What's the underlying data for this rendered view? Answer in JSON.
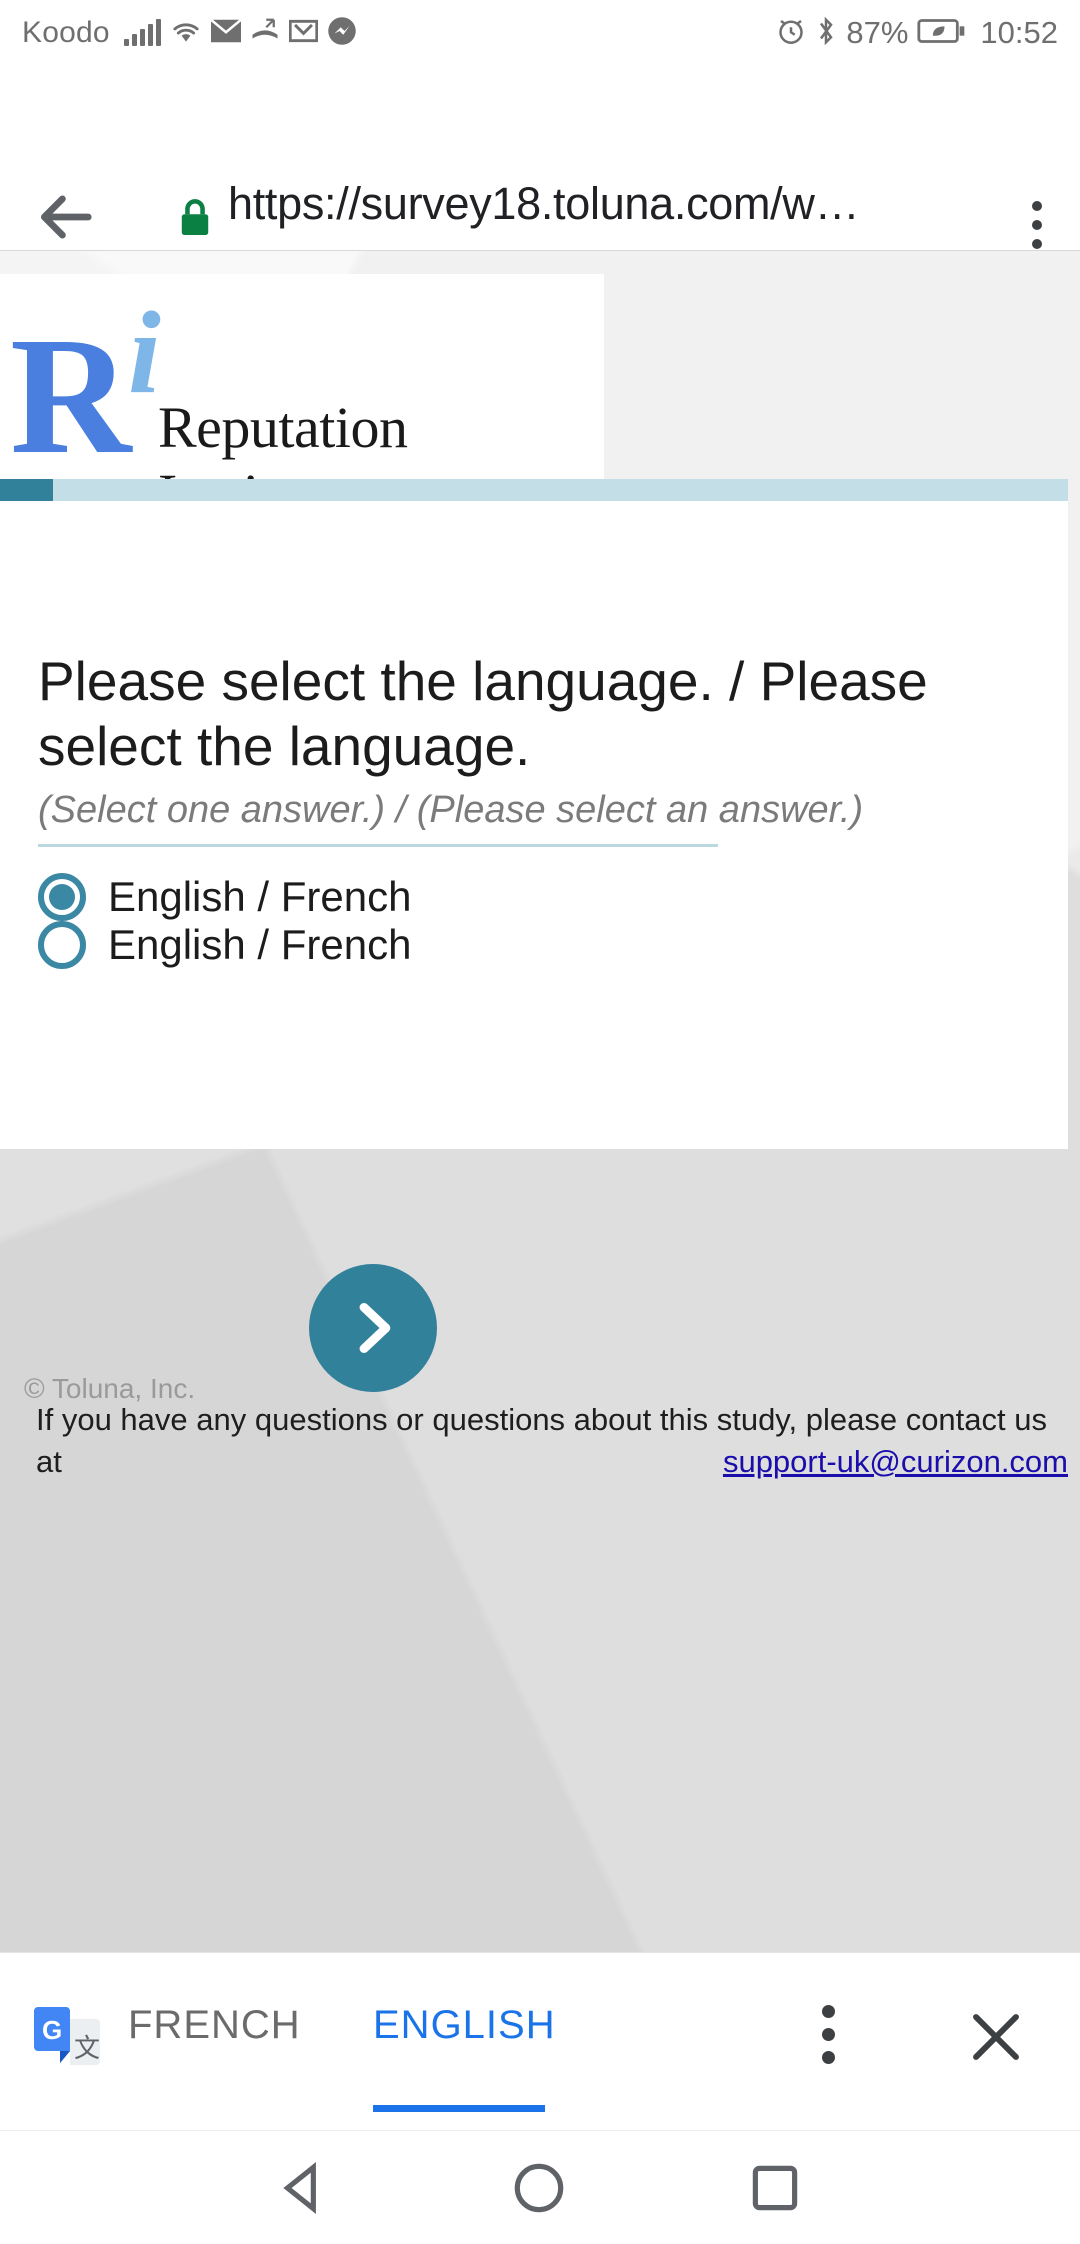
{
  "status_bar": {
    "carrier": "Koodo",
    "battery_percent": "87%",
    "time": "10:52",
    "icons": [
      "signal-icon",
      "wifi-icon",
      "mail-icon",
      "missed-call-icon",
      "gmail-icon",
      "messenger-icon",
      "alarm-icon",
      "bluetooth-icon",
      "battery-saver-icon"
    ]
  },
  "browser": {
    "url_display": "https://survey18.toluna.com/w…",
    "url_scheme": "https",
    "url_host": "://survey18.toluna.com",
    "back_icon": "back-arrow-icon",
    "lock_icon": "lock-icon",
    "menu_icon": "overflow-menu-icon"
  },
  "brand": {
    "letter_r": "R",
    "letter_i": "i",
    "name": "Reputation Institute"
  },
  "progress": {
    "percent": 5,
    "fill_color": "#31819b",
    "track_color": "#c3dee7"
  },
  "survey": {
    "question": "Please select the language. / Please select the language.",
    "instruction": "(Select one answer.) / (Please select an answer.)",
    "options": [
      {
        "label": "English / French",
        "selected": true
      },
      {
        "label": "English / French",
        "selected": false
      }
    ],
    "next_button_icon": "chevron-right-icon",
    "accent_color": "#31819b"
  },
  "footer": {
    "copyright": "© Toluna, Inc.",
    "contact_text": "If you have any questions or questions about this study, please contact us at",
    "contact_email": "support-uk@curizon.com"
  },
  "translate_bar": {
    "app_icon": "google-translate-icon",
    "source_language": "FRENCH",
    "target_language": "ENGLISH",
    "active_language": "ENGLISH",
    "menu_icon": "overflow-menu-icon",
    "close_icon": "close-icon",
    "accent_color": "#1a73e8"
  },
  "navigation_bar": {
    "back_icon": "nav-back-triangle-icon",
    "home_icon": "nav-home-circle-icon",
    "recents_icon": "nav-recents-square-icon"
  }
}
